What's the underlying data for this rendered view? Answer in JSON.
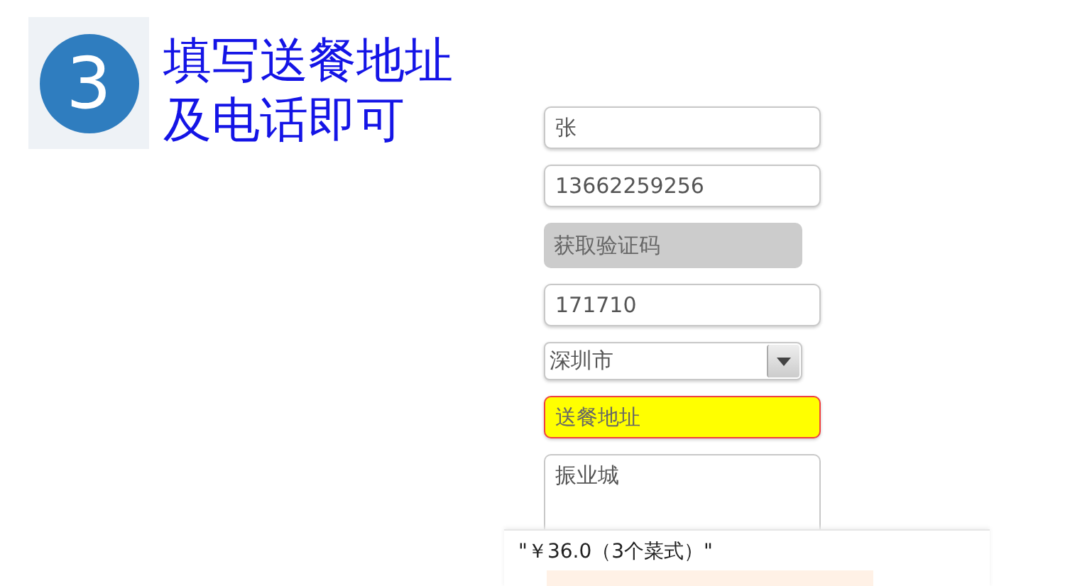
{
  "step": {
    "number": "3",
    "lines": [
      "填写送餐地址",
      "及电话即可"
    ]
  },
  "form": [
    {
      "kind": "input",
      "value": "张"
    },
    {
      "kind": "input",
      "value": "13662259256"
    },
    {
      "kind": "button",
      "label": "获取验证码",
      "disabled": true
    },
    {
      "kind": "input",
      "value": "171710"
    },
    {
      "kind": "select",
      "value": "深圳市"
    },
    {
      "kind": "input",
      "placeholder": "送餐地址",
      "highlighted": true
    },
    {
      "kind": "textarea",
      "value": "振业城"
    }
  ],
  "order_bar": {
    "total": "\"￥36.0（3个菜式）\""
  }
}
